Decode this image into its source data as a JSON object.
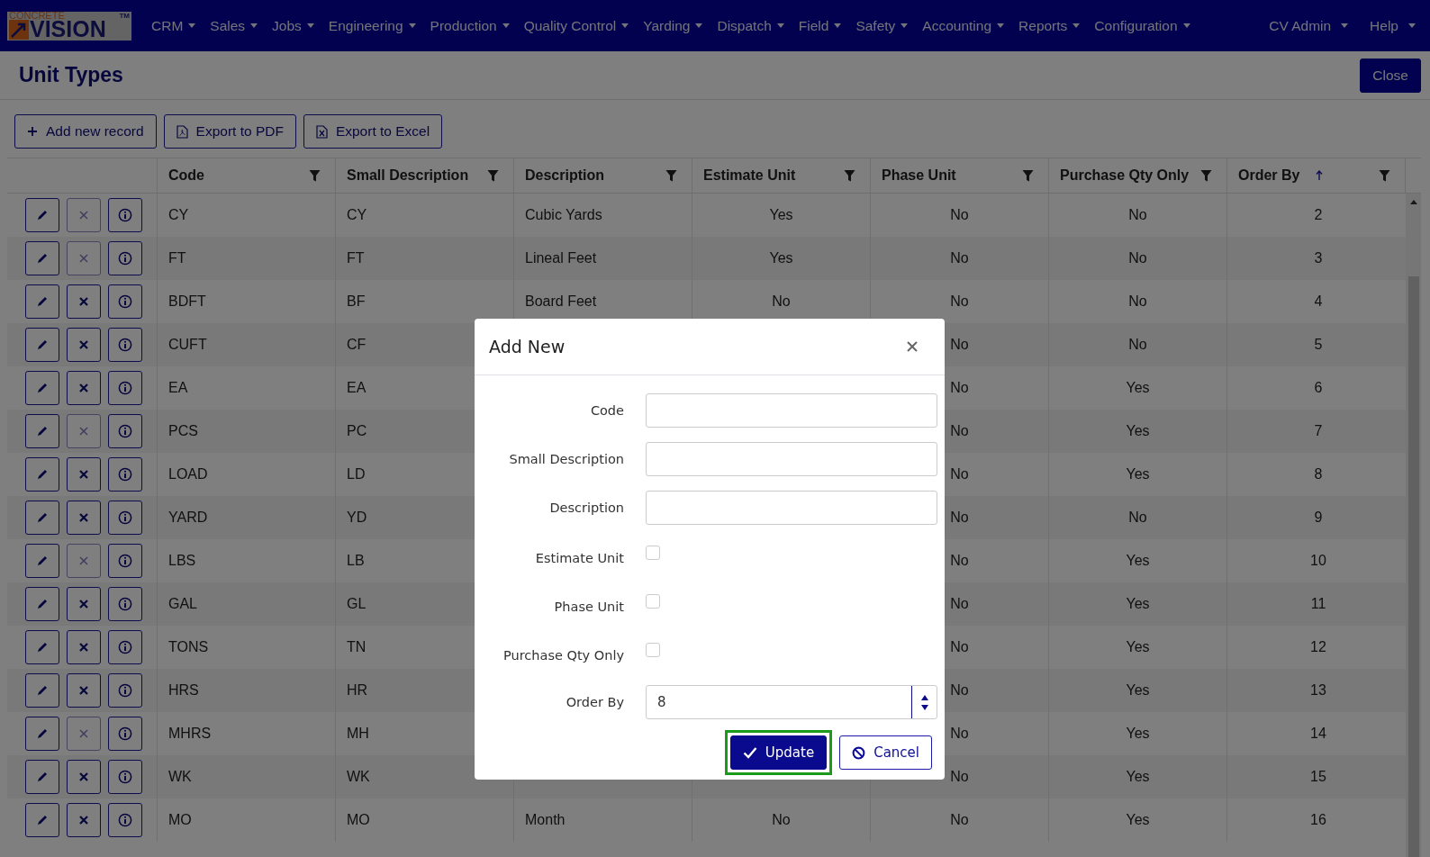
{
  "nav": {
    "logo": {
      "top": "CONCRETE",
      "main": "VISION",
      "mark": "TM"
    },
    "menus": [
      {
        "label": "CRM"
      },
      {
        "label": "Sales"
      },
      {
        "label": "Jobs"
      },
      {
        "label": "Engineering"
      },
      {
        "label": "Production"
      },
      {
        "label": "Quality Control"
      },
      {
        "label": "Yarding"
      },
      {
        "label": "Dispatch"
      },
      {
        "label": "Field"
      },
      {
        "label": "Safety"
      },
      {
        "label": "Accounting"
      },
      {
        "label": "Reports"
      },
      {
        "label": "Configuration"
      }
    ],
    "user_menus": [
      {
        "label": "CV Admin"
      },
      {
        "label": "Help"
      }
    ]
  },
  "page": {
    "title": "Unit Types",
    "close": "Close"
  },
  "toolbar": [
    {
      "label": "Add new record"
    },
    {
      "label": "Export to PDF"
    },
    {
      "label": "Export to Excel"
    }
  ],
  "table": {
    "columns": [
      {
        "label": "Code",
        "kind": "text",
        "sorted": false
      },
      {
        "label": "Small Description",
        "kind": "text",
        "sorted": false
      },
      {
        "label": "Description",
        "kind": "text",
        "sorted": false
      },
      {
        "label": "Estimate Unit",
        "kind": "flag",
        "sorted": false
      },
      {
        "label": "Phase Unit",
        "kind": "flag",
        "sorted": false
      },
      {
        "label": "Purchase Qty Only",
        "kind": "flag",
        "sorted": false
      },
      {
        "label": "Order By",
        "kind": "number",
        "sorted": true
      }
    ],
    "rows": [
      {
        "delete_disabled": true,
        "cells": [
          "CY",
          "CY",
          "Cubic Yards",
          "Yes",
          "No",
          "No",
          "2"
        ]
      },
      {
        "delete_disabled": true,
        "cells": [
          "FT",
          "FT",
          "Lineal Feet",
          "Yes",
          "No",
          "No",
          "3"
        ]
      },
      {
        "delete_disabled": false,
        "cells": [
          "BDFT",
          "BF",
          "Board Feet",
          "No",
          "No",
          "No",
          "4"
        ]
      },
      {
        "delete_disabled": false,
        "cells": [
          "CUFT",
          "CF",
          null,
          null,
          "No",
          "No",
          "5"
        ]
      },
      {
        "delete_disabled": false,
        "cells": [
          "EA",
          "EA",
          null,
          null,
          "No",
          "Yes",
          "6"
        ]
      },
      {
        "delete_disabled": true,
        "cells": [
          "PCS",
          "PC",
          null,
          null,
          "No",
          "Yes",
          "7"
        ]
      },
      {
        "delete_disabled": false,
        "cells": [
          "LOAD",
          "LD",
          null,
          null,
          "No",
          "Yes",
          "8"
        ]
      },
      {
        "delete_disabled": false,
        "cells": [
          "YARD",
          "YD",
          null,
          null,
          "No",
          "No",
          "9"
        ]
      },
      {
        "delete_disabled": true,
        "cells": [
          "LBS",
          "LB",
          null,
          null,
          "No",
          "Yes",
          "10"
        ]
      },
      {
        "delete_disabled": false,
        "cells": [
          "GAL",
          "GL",
          null,
          null,
          "No",
          "Yes",
          "11"
        ]
      },
      {
        "delete_disabled": false,
        "cells": [
          "TONS",
          "TN",
          null,
          null,
          "No",
          "Yes",
          "12"
        ]
      },
      {
        "delete_disabled": false,
        "cells": [
          "HRS",
          "HR",
          null,
          null,
          "No",
          "Yes",
          "13"
        ]
      },
      {
        "delete_disabled": true,
        "cells": [
          "MHRS",
          "MH",
          null,
          null,
          "No",
          "Yes",
          "14"
        ]
      },
      {
        "delete_disabled": false,
        "cells": [
          "WK",
          "WK",
          null,
          null,
          "No",
          "Yes",
          "15"
        ]
      },
      {
        "delete_disabled": false,
        "cells": [
          "MO",
          "MO",
          "Month",
          "No",
          "No",
          "Yes",
          "16"
        ]
      }
    ]
  },
  "dialog": {
    "title": "Add New",
    "fields": [
      {
        "kind": "text",
        "label": "Code"
      },
      {
        "kind": "text",
        "label": "Small Description"
      },
      {
        "kind": "text",
        "label": "Description"
      },
      {
        "kind": "checkbox",
        "label": "Estimate Unit",
        "checked": false
      },
      {
        "kind": "checkbox",
        "label": "Phase Unit",
        "checked": false
      },
      {
        "kind": "checkbox",
        "label": "Purchase Qty Only",
        "checked": false
      },
      {
        "kind": "number",
        "label": "Order By",
        "value": "8"
      }
    ],
    "buttons": [
      {
        "kind": "primary",
        "label": "Update",
        "focused": true
      },
      {
        "kind": "secondary",
        "label": "Cancel",
        "focused": false
      }
    ]
  }
}
